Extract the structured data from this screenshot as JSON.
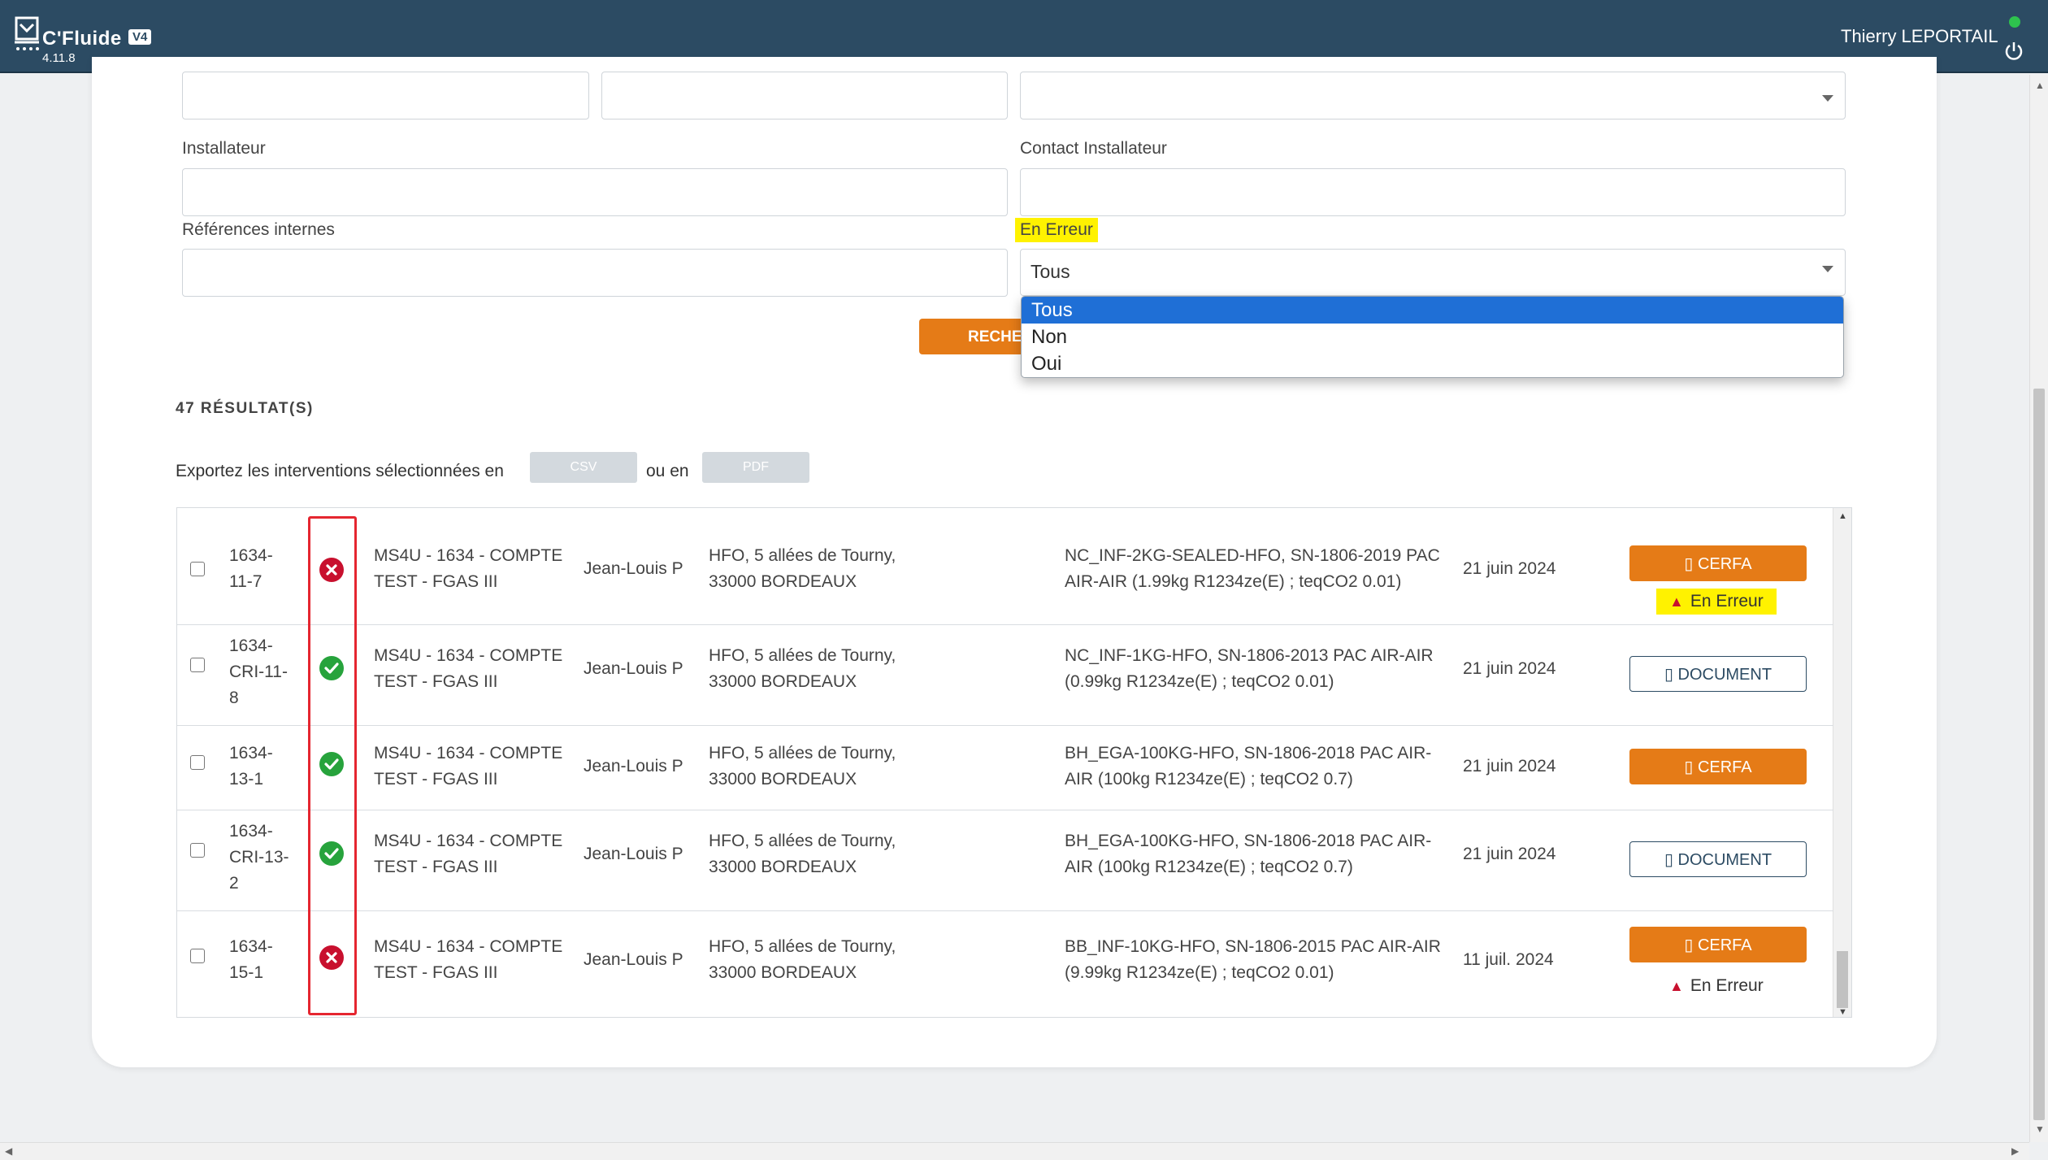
{
  "app": {
    "brand": "C'Fluide",
    "version_badge": "V4",
    "build": "4.11.8",
    "user_name": "Thierry LEPORTAIL"
  },
  "form": {
    "installateur_label": "Installateur",
    "contact_label": "Contact Installateur",
    "references_label": "Références internes",
    "en_erreur_label": "En Erreur",
    "en_erreur_value": "Tous",
    "search_button": "RECHERCHER",
    "dropdown_options": [
      "Tous",
      "Non",
      "Oui"
    ]
  },
  "results": {
    "count_label": "47 RÉSULTAT(S)",
    "export_prefix": "Exportez les interventions sélectionnées en",
    "export_or": "ou en",
    "csv_label": "CSV",
    "pdf_label": "PDF"
  },
  "rows": [
    {
      "id_line1": "1634-",
      "id_line2": "11-7",
      "id_line3": "",
      "status": "error",
      "site_line1": "MS4U - 1634 - COMPTE",
      "site_line2": "TEST - FGAS III",
      "tech": "Jean-Louis P",
      "addr_line1": "HFO, 5 allées de Tourny,",
      "addr_line2": "33000 BORDEAUX",
      "equip_line1": "NC_INF-2KG-SEALED-HFO, SN-1806-2019 PAC",
      "equip_line2": "AIR-AIR (1.99kg R1234ze(E) ; teqCO2 0.01)",
      "date": "21 juin 2024",
      "action": "CERFA",
      "error_label": "En Erreur"
    },
    {
      "id_line1": "1634-",
      "id_line2": "CRI-11-",
      "id_line3": "8",
      "status": "ok",
      "site_line1": "MS4U - 1634 - COMPTE",
      "site_line2": "TEST - FGAS III",
      "tech": "Jean-Louis P",
      "addr_line1": "HFO, 5 allées de Tourny,",
      "addr_line2": "33000 BORDEAUX",
      "equip_line1": "NC_INF-1KG-HFO, SN-1806-2013 PAC AIR-AIR",
      "equip_line2": "(0.99kg R1234ze(E) ; teqCO2 0.01)",
      "date": "21 juin 2024",
      "action": "DOCUMENT",
      "error_label": ""
    },
    {
      "id_line1": "1634-",
      "id_line2": "13-1",
      "id_line3": "",
      "status": "ok",
      "site_line1": "MS4U - 1634 - COMPTE",
      "site_line2": "TEST - FGAS III",
      "tech": "Jean-Louis P",
      "addr_line1": "HFO, 5 allées de Tourny,",
      "addr_line2": "33000 BORDEAUX",
      "equip_line1": "BH_EGA-100KG-HFO, SN-1806-2018 PAC AIR-",
      "equip_line2": "AIR (100kg R1234ze(E) ; teqCO2 0.7)",
      "date": "21 juin 2024",
      "action": "CERFA",
      "error_label": ""
    },
    {
      "id_line1": "1634-",
      "id_line2": "CRI-13-",
      "id_line3": "2",
      "status": "ok",
      "site_line1": "MS4U - 1634 - COMPTE",
      "site_line2": "TEST - FGAS III",
      "tech": "Jean-Louis P",
      "addr_line1": "HFO, 5 allées de Tourny,",
      "addr_line2": "33000 BORDEAUX",
      "equip_line1": "BH_EGA-100KG-HFO, SN-1806-2018 PAC AIR-",
      "equip_line2": "AIR (100kg R1234ze(E) ; teqCO2 0.7)",
      "date": "21 juin 2024",
      "action": "DOCUMENT",
      "error_label": ""
    },
    {
      "id_line1": "1634-",
      "id_line2": "15-1",
      "id_line3": "",
      "status": "error",
      "site_line1": "MS4U - 1634 - COMPTE",
      "site_line2": "TEST - FGAS III",
      "tech": "Jean-Louis P",
      "addr_line1": "HFO, 5 allées de Tourny,",
      "addr_line2": "33000 BORDEAUX",
      "equip_line1": "BB_INF-10KG-HFO, SN-1806-2015 PAC AIR-AIR",
      "equip_line2": "(9.99kg R1234ze(E) ; teqCO2 0.01)",
      "date": "11 juil. 2024",
      "action": "CERFA",
      "error_label": "En Erreur"
    }
  ],
  "colors": {
    "header": "#2c4b63",
    "accent": "#e57b17",
    "error": "#c8102e",
    "ok": "#27a33c",
    "highlight": "#fff200"
  }
}
